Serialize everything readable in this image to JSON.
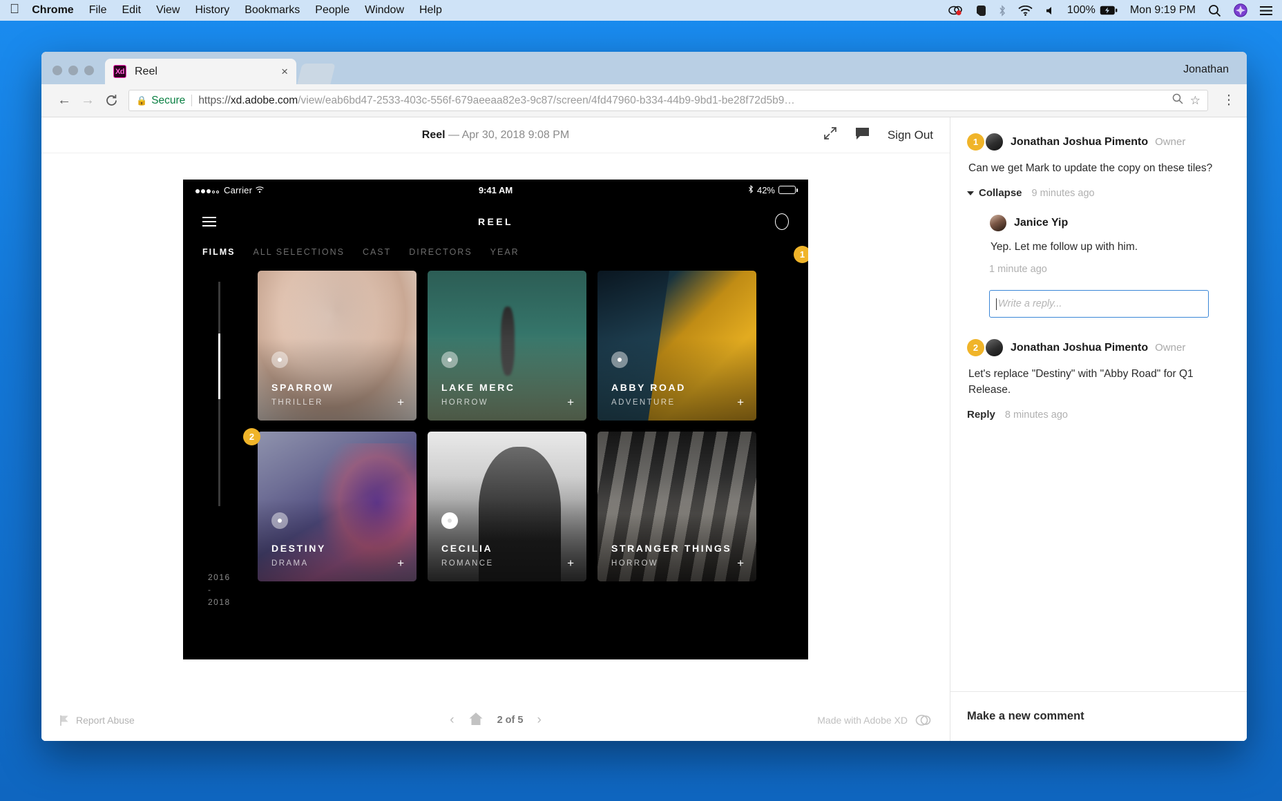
{
  "menubar": {
    "apple_icon": "apple-icon",
    "items": [
      {
        "label": "Chrome",
        "bold": true
      },
      {
        "label": "File",
        "bold": false
      },
      {
        "label": "Edit",
        "bold": false
      },
      {
        "label": "View",
        "bold": false
      },
      {
        "label": "History",
        "bold": false
      },
      {
        "label": "Bookmarks",
        "bold": false
      },
      {
        "label": "People",
        "bold": false
      },
      {
        "label": "Window",
        "bold": false
      },
      {
        "label": "Help",
        "bold": false
      }
    ],
    "status": {
      "battery_percent": "100%",
      "clock": "Mon 9:19 PM"
    }
  },
  "browser": {
    "tab": {
      "title": "Reel",
      "favicon_label": "Xd",
      "close_label": "×"
    },
    "profile": "Jonathan",
    "omnibox": {
      "security_label": "Secure",
      "url_scheme": "https://",
      "url_domain": "xd.adobe.com",
      "url_path": "/view/eab6bd47-2533-403c-556f-679aeeaa82e3-9c87/screen/4fd47960-b334-44b9-9bd1-be28f72d5b9…",
      "full_url": "https://xd.adobe.com/view/eab6bd47-2533-403c-556f-679aeeaa82e3-9c87/screen/4fd47960-b334-44b9-9bd1-be28f72d5b9…"
    }
  },
  "viewer": {
    "doc_name": "Reel",
    "doc_date": "— Apr 30, 2018 9:08 PM",
    "sign_out": "Sign Out",
    "footer": {
      "report_abuse": "Report Abuse",
      "page_indicator": "2 of 5",
      "made_with": "Made with Adobe XD"
    }
  },
  "prototype": {
    "status_bar": {
      "carrier": "Carrier",
      "time": "9:41 AM",
      "battery": "42%"
    },
    "brand": "REEL",
    "filters": [
      {
        "label": "FILMS",
        "active": true
      },
      {
        "label": "ALL SELECTIONS",
        "active": false
      },
      {
        "label": "CAST",
        "active": false
      },
      {
        "label": "DIRECTORS",
        "active": false
      },
      {
        "label": "YEAR",
        "active": false
      }
    ],
    "year_range": "2016\n-\n2018",
    "tiles": [
      {
        "title": "SPARROW",
        "genre": "THRILLER",
        "plus": "+"
      },
      {
        "title": "LAKE MERC",
        "genre": "HORROW",
        "plus": "+"
      },
      {
        "title": "ABBY ROAD",
        "genre": "ADVENTURE",
        "plus": "+"
      },
      {
        "title": "DESTINY",
        "genre": "DRAMA",
        "plus": "+"
      },
      {
        "title": "CECILIA",
        "genre": "ROMANCE",
        "plus": "+"
      },
      {
        "title": "STRANGER THINGS",
        "genre": "HORROW",
        "plus": "+"
      }
    ],
    "pins": [
      {
        "number": "1"
      },
      {
        "number": "2"
      }
    ]
  },
  "sidebar": {
    "comment1": {
      "badge": "1",
      "author": "Jonathan Joshua Pimento",
      "role": "Owner",
      "body": "Can we get Mark to update the copy on these tiles?",
      "action": "Collapse",
      "time": "9 minutes ago",
      "reply": {
        "author": "Janice Yip",
        "body": "Yep. Let me follow up with him.",
        "time": "1 minute ago"
      },
      "reply_placeholder": "Write a reply..."
    },
    "comment2": {
      "badge": "2",
      "author": "Jonathan Joshua Pimento",
      "role": "Owner",
      "body": "Let's replace \"Destiny\" with \"Abby Road\" for Q1 Release.",
      "action": "Reply",
      "time": "8 minutes ago"
    },
    "new_comment": "Make a new comment"
  },
  "colors": {
    "accent_yellow": "#f0b429",
    "focus_blue": "#3a86d6",
    "secure_green": "#0b8043",
    "desktop_blue": "#1478d8"
  }
}
